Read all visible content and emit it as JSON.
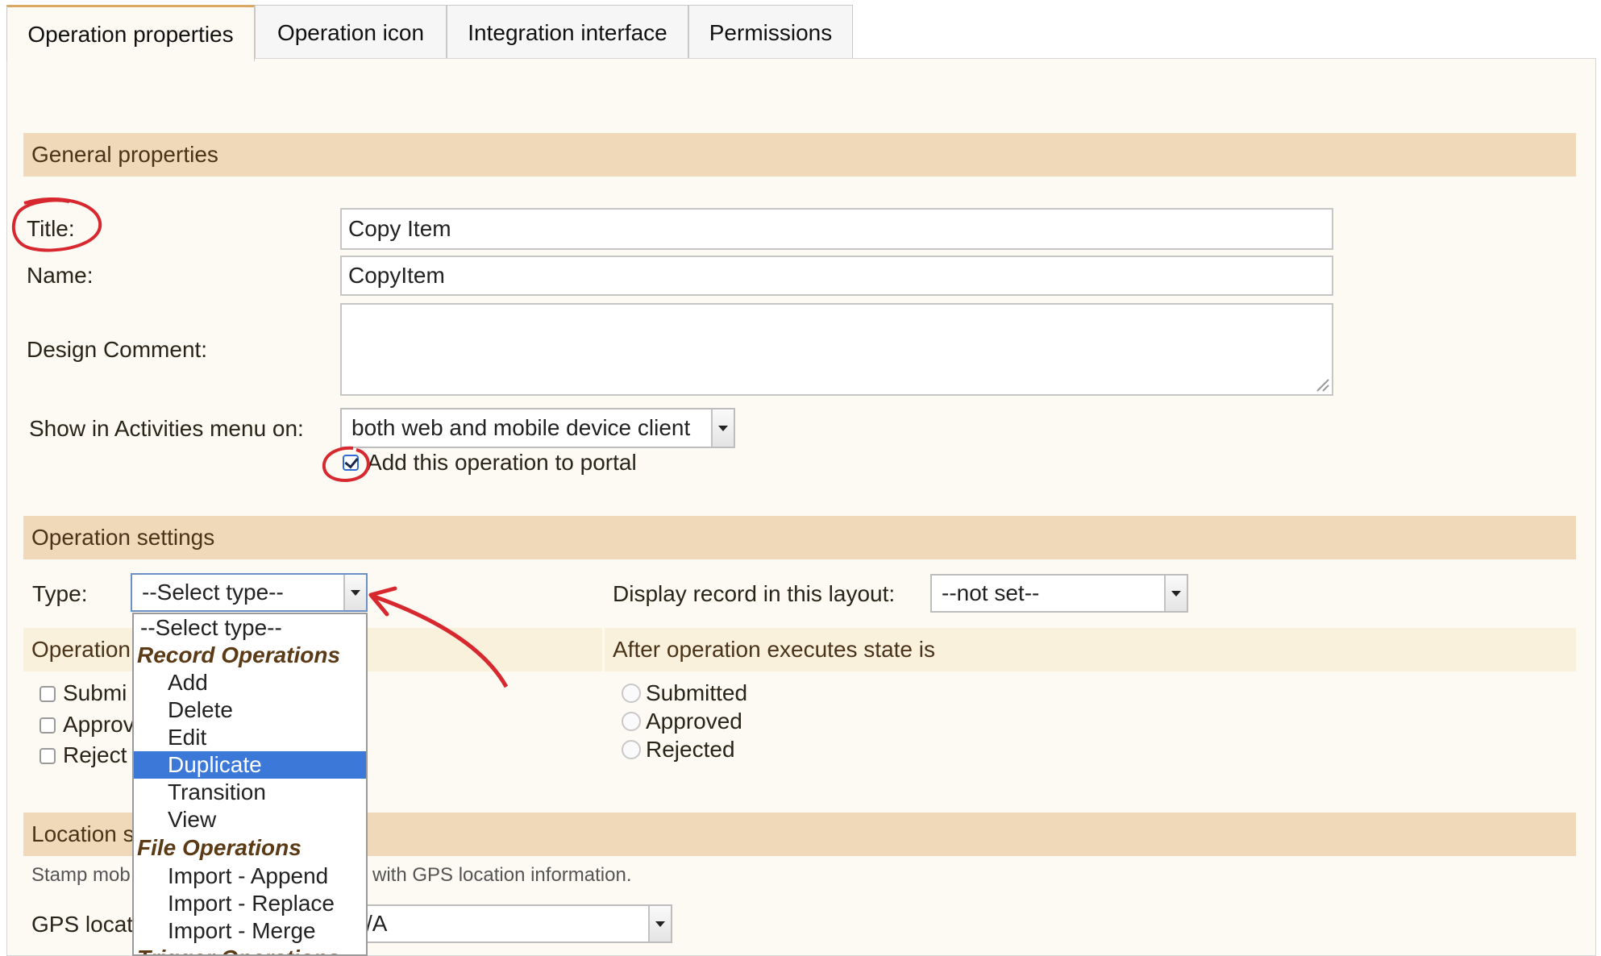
{
  "tabs": [
    {
      "label": "Operation properties"
    },
    {
      "label": "Operation icon"
    },
    {
      "label": "Integration interface"
    },
    {
      "label": "Permissions"
    }
  ],
  "general": {
    "section_title": "General properties",
    "title_label": "Title:",
    "title_value": "Copy Item",
    "name_label": "Name:",
    "name_value": "CopyItem",
    "design_comment_label": "Design Comment:",
    "design_comment_value": "",
    "show_in_menu_label": "Show in Activities menu on:",
    "show_in_menu_value": "both web and mobile device client",
    "portal_checkbox_label": "Add this operation to portal",
    "portal_checked": true
  },
  "operation_settings": {
    "section_title": "Operation settings",
    "type_label": "Type:",
    "type_value": "--Select type--",
    "display_layout_label": "Display record in this layout:",
    "display_layout_value": "--not set--",
    "operation_sub_header": "Operation",
    "state_sub_header": "After operation executes state is",
    "left_checkboxes": [
      {
        "label": "Submi"
      },
      {
        "label": "Approv"
      },
      {
        "label": "Reject"
      }
    ],
    "state_radios": [
      {
        "label": "Submitted"
      },
      {
        "label": "Approved"
      },
      {
        "label": "Rejected"
      }
    ]
  },
  "type_dropdown": {
    "items": [
      {
        "label": "--Select type--",
        "kind": "header"
      },
      {
        "label": "Record Operations",
        "kind": "group"
      },
      {
        "label": "Add",
        "kind": "option"
      },
      {
        "label": "Delete",
        "kind": "option"
      },
      {
        "label": "Edit",
        "kind": "option"
      },
      {
        "label": "Duplicate",
        "kind": "option",
        "selected": true
      },
      {
        "label": "Transition",
        "kind": "option"
      },
      {
        "label": "View",
        "kind": "option"
      },
      {
        "label": "File Operations",
        "kind": "group"
      },
      {
        "label": "Import - Append",
        "kind": "option"
      },
      {
        "label": "Import - Replace",
        "kind": "option"
      },
      {
        "label": "Import - Merge",
        "kind": "option"
      },
      {
        "label": "Trigger Operations",
        "kind": "group"
      }
    ]
  },
  "location": {
    "section_title": "Location s",
    "description_left": "Stamp mob",
    "description_right": "with GPS location information.",
    "gps_label": "GPS locat",
    "gps_value": "/A"
  },
  "colors": {
    "section_bar": "#f0d9b8",
    "panel_bg": "#fdf9f3",
    "selected_option": "#3b78d8",
    "annotation_red": "#d8282f"
  }
}
